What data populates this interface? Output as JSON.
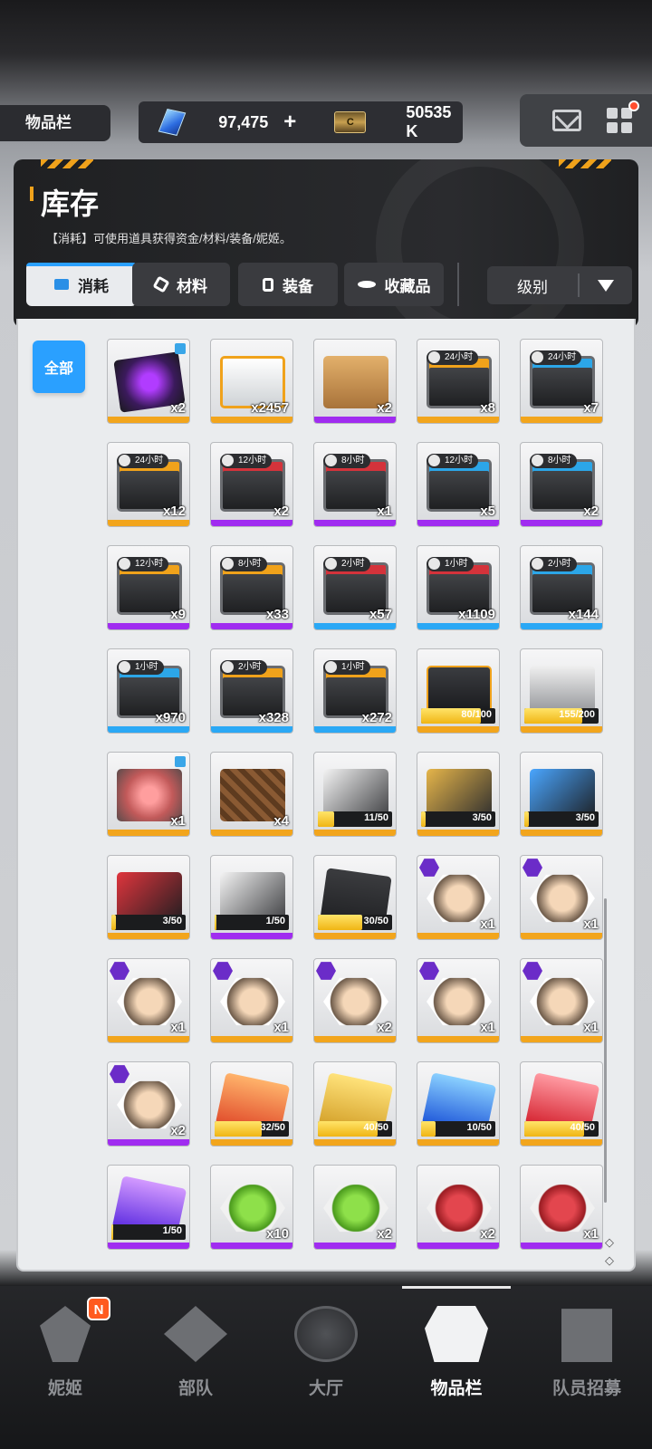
{
  "topbar": {
    "screen_tag": "物品栏",
    "gems": "97,475",
    "gems_plus": "+",
    "credits": "50535 K"
  },
  "header": {
    "title": "库存",
    "description": "【消耗】可使用道具获得资金/材料/装备/妮姬。",
    "tabs": [
      {
        "label": "消耗",
        "icon": "consumable-icon",
        "active": true
      },
      {
        "label": "材料",
        "icon": "material-icon",
        "active": false
      },
      {
        "label": "装备",
        "icon": "equipment-icon",
        "active": false
      },
      {
        "label": "收藏品",
        "icon": "collection-icon",
        "active": false
      }
    ],
    "sort_label": "级别"
  },
  "filter": {
    "all_label": "全部"
  },
  "items": [
    {
      "art": "gift",
      "rarity": "gold",
      "count": "x2",
      "locked": true
    },
    {
      "art": "box-white",
      "rarity": "gold",
      "count": "x2457"
    },
    {
      "art": "cardboard",
      "rarity": "purple",
      "count": "x2"
    },
    {
      "art": "crate orange",
      "rarity": "gold",
      "timer": "24小时",
      "count": "x8"
    },
    {
      "art": "crate blue",
      "rarity": "gold",
      "timer": "24小时",
      "count": "x7"
    },
    {
      "art": "crate orange",
      "rarity": "gold",
      "timer": "24小时",
      "count": "x12"
    },
    {
      "art": "crate red",
      "rarity": "purple",
      "timer": "12小时",
      "count": "x2"
    },
    {
      "art": "crate red",
      "rarity": "purple",
      "timer": "8小时",
      "count": "x1"
    },
    {
      "art": "crate blue",
      "rarity": "purple",
      "timer": "12小时",
      "count": "x5"
    },
    {
      "art": "crate blue",
      "rarity": "purple",
      "timer": "8小时",
      "count": "x2"
    },
    {
      "art": "crate orange",
      "rarity": "purple",
      "timer": "12小时",
      "count": "x9"
    },
    {
      "art": "crate orange",
      "rarity": "purple",
      "timer": "8小时",
      "count": "x33"
    },
    {
      "art": "crate red",
      "rarity": "blue",
      "timer": "2小时",
      "count": "x57"
    },
    {
      "art": "crate red",
      "rarity": "blue",
      "timer": "1小时",
      "count": "x1109"
    },
    {
      "art": "crate blue",
      "rarity": "blue",
      "timer": "2小时",
      "count": "x144"
    },
    {
      "art": "crate blue",
      "rarity": "blue",
      "timer": "1小时",
      "count": "x970"
    },
    {
      "art": "crate orange",
      "rarity": "blue",
      "timer": "2小时",
      "count": "x328"
    },
    {
      "art": "crate orange",
      "rarity": "blue",
      "timer": "1小时",
      "count": "x272"
    },
    {
      "art": "case",
      "rarity": "gold",
      "progress": "80/100",
      "fill": 0.8
    },
    {
      "art": "silver",
      "rarity": "gold",
      "progress": "155/200",
      "fill": 0.775
    },
    {
      "art": "cake",
      "rarity": "gold",
      "count": "x1",
      "locked": true
    },
    {
      "art": "basket",
      "rarity": "gold",
      "count": "x4"
    },
    {
      "art": "folder white",
      "rarity": "gold",
      "progress": "11/50",
      "fill": 0.22
    },
    {
      "art": "folder gold",
      "rarity": "gold",
      "progress": "3/50",
      "fill": 0.06
    },
    {
      "art": "folder blue",
      "rarity": "gold",
      "progress": "3/50",
      "fill": 0.06
    },
    {
      "art": "folder red",
      "rarity": "gold",
      "progress": "3/50",
      "fill": 0.06
    },
    {
      "art": "folder white",
      "rarity": "purple",
      "progress": "1/50",
      "fill": 0.02
    },
    {
      "art": "card",
      "rarity": "gold",
      "progress": "30/50",
      "fill": 0.6
    },
    {
      "art": "hex portrait",
      "rarity": "gold",
      "count": "x1",
      "corner_badge": true
    },
    {
      "art": "hex portrait",
      "rarity": "gold",
      "count": "x1",
      "corner_badge": true
    },
    {
      "art": "hex portrait",
      "rarity": "gold",
      "count": "x1",
      "corner_badge": true
    },
    {
      "art": "hex portrait",
      "rarity": "gold",
      "count": "x1",
      "corner_badge": true
    },
    {
      "art": "hex portrait",
      "rarity": "gold",
      "count": "x2",
      "corner_badge": true
    },
    {
      "art": "hex portrait",
      "rarity": "gold",
      "count": "x1",
      "corner_badge": true
    },
    {
      "art": "hex portrait",
      "rarity": "gold",
      "count": "x1",
      "corner_badge": true
    },
    {
      "art": "hex portrait",
      "rarity": "purple",
      "count": "x2",
      "corner_badge": true
    },
    {
      "art": "ssr orange",
      "rarity": "gold",
      "progress": "32/50",
      "fill": 0.64
    },
    {
      "art": "ssr gold",
      "rarity": "gold",
      "progress": "40/50",
      "fill": 0.8
    },
    {
      "art": "ssr blue",
      "rarity": "gold",
      "progress": "10/50",
      "fill": 0.2
    },
    {
      "art": "ssr red",
      "rarity": "gold",
      "progress": "40/50",
      "fill": 0.8
    },
    {
      "art": "ssr purple",
      "rarity": "purple",
      "progress": "1/50",
      "fill": 0.02
    },
    {
      "art": "hex green",
      "rarity": "purple",
      "count": "x10"
    },
    {
      "art": "hex green",
      "rarity": "purple",
      "count": "x2"
    },
    {
      "art": "hex red",
      "rarity": "purple",
      "count": "x2"
    },
    {
      "art": "hex red",
      "rarity": "purple",
      "count": "x1"
    }
  ],
  "bottom_nav": [
    {
      "label": "妮姬",
      "icon": "nikke-icon",
      "badge": "N"
    },
    {
      "label": "部队",
      "icon": "squad-icon"
    },
    {
      "label": "大厅",
      "icon": "lobby-icon"
    },
    {
      "label": "物品栏",
      "icon": "inventory-icon",
      "active": true
    },
    {
      "label": "队员招募",
      "icon": "recruit-icon"
    }
  ],
  "colors": {
    "rarity_gold": "#f2a51c",
    "rarity_purple": "#a02cf0",
    "rarity_blue": "#2aa8f5",
    "accent_blue": "#2aa0ff",
    "accent_orange": "#f0a21b"
  }
}
